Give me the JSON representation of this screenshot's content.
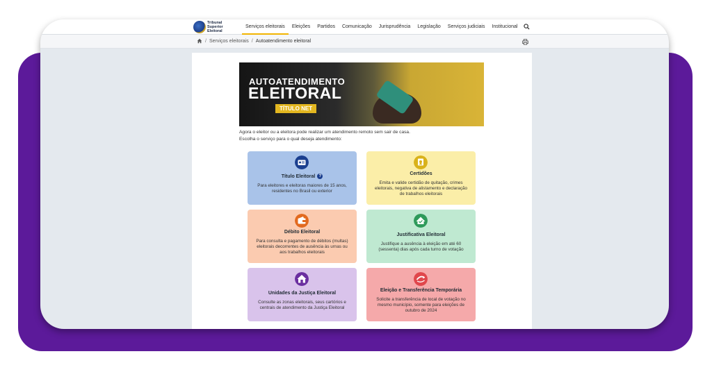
{
  "header": {
    "logo_text": "Tribunal Superior Eleitoral",
    "nav": [
      {
        "label": "Serviços eleitorais",
        "active": true
      },
      {
        "label": "Eleições"
      },
      {
        "label": "Partidos"
      },
      {
        "label": "Comunicação"
      },
      {
        "label": "Jurisprudência"
      },
      {
        "label": "Legislação"
      },
      {
        "label": "Serviços judiciais"
      },
      {
        "label": "Institucional"
      }
    ]
  },
  "breadcrumb": {
    "items": [
      "Serviços eleitorais",
      "Autoatendimento eleitoral"
    ],
    "sep": "/"
  },
  "banner": {
    "line1": "AUTOATENDIMENTO",
    "line2": "ELEITORAL",
    "badge": "TÍTULO NET"
  },
  "intro": {
    "line1": "Agora o eleitor ou a eleitora pode realizar um atendimento remoto sem sair de casa.",
    "line2": "Escolha o serviço para o qual deseja atendimento:"
  },
  "cards": [
    {
      "title": "Título Eleitoral",
      "desc": "Para eleitores e eleitoras maiores de 15 anos, residentes no Brasil ou exterior",
      "color": "#a9c3e9",
      "icon": "id-card-icon",
      "icon_color": "#1b3f8f"
    },
    {
      "title": "Certidões",
      "desc": "Emita e valide certidão de quitação, crimes eleitorais, negativa de alistamento e declaração de trabalhos eleitorais",
      "color": "#fbeea8",
      "icon": "certificate-icon",
      "icon_color": "#d9b21a"
    },
    {
      "title": "Débito Eleitoral",
      "desc": "Para consulta e pagamento de débitos (multas) eleitorais decorrentes de ausência às urnas ou aos trabalhos eleitorais",
      "color": "#fbcbb0",
      "icon": "wallet-icon",
      "icon_color": "#e26a1f"
    },
    {
      "title": "Justificativa Eleitoral",
      "desc": "Justifique a ausência à eleição em até 60 (sessenta) dias após cada turno de votação",
      "color": "#bfe9d1",
      "icon": "justification-icon",
      "icon_color": "#2e9a5a"
    },
    {
      "title": "Unidades da Justiça Eleitoral",
      "desc": "Consulte as zonas eleitorais, seus cartórios e centrais de atendimento da Justiça Eleitoral",
      "color": "#d9c3eb",
      "icon": "building-icon",
      "icon_color": "#6b2fa0"
    },
    {
      "title": "Eleição e Transferência Temporária",
      "desc": "Solicite a transferência de local de votação no mesmo município, somente para eleições de outubro de 2024",
      "color": "#f5a9aa",
      "icon": "transfer-icon",
      "icon_color": "#e0474c"
    }
  ]
}
